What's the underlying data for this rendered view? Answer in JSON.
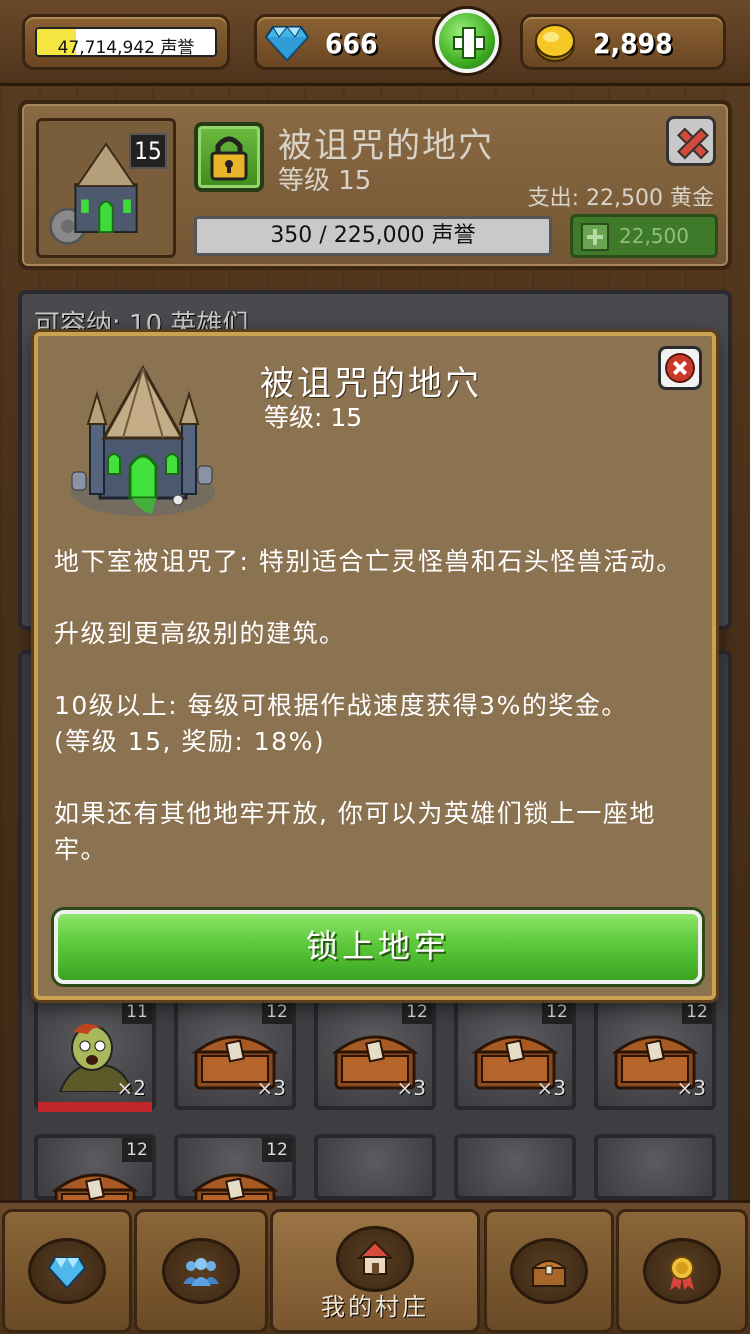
{
  "topbar": {
    "reputation": {
      "text": "47,714,942 声誉",
      "fill_fraction": 0.22
    },
    "gems": {
      "value": "666"
    },
    "gold": {
      "value": "2,898"
    }
  },
  "building": {
    "name": "被诅咒的地穴",
    "level_text": "等级 15",
    "thumb_level": "15",
    "cost_text": "支出: 22,500 黄金",
    "progress_text": "350 / 225,000 声誉",
    "upgrade_cost": "22,500"
  },
  "dungeon": {
    "capacity_text": "可容纳: 10 英雄们"
  },
  "modal": {
    "title": "被诅咒的地穴",
    "level_text": "等级: 15",
    "paragraphs": [
      "地下室被诅咒了: 特别适合亡灵怪兽和石头怪兽活动。",
      "升级到更高级别的建筑。",
      "10级以上: 每级可根据作战速度获得3%的奖金。",
      "(等级 15, 奖励: 18%)",
      "如果还有其他地牢开放, 你可以为英雄们锁上一座地牢。"
    ],
    "button_label": "锁上地牢"
  },
  "slots": [
    {
      "level": "11",
      "count": "×2",
      "item": "zombie"
    },
    {
      "level": "12",
      "count": "×3",
      "item": "chest"
    },
    {
      "level": "12",
      "count": "×3",
      "item": "chest"
    },
    {
      "level": "12",
      "count": "×3",
      "item": "chest"
    },
    {
      "level": "12",
      "count": "×3",
      "item": "chest"
    },
    {
      "level": "12",
      "count": "",
      "item": "chest"
    },
    {
      "level": "12",
      "count": "",
      "item": "chest"
    },
    {
      "level": "",
      "count": "",
      "item": "empty"
    },
    {
      "level": "",
      "count": "",
      "item": "empty"
    },
    {
      "level": "",
      "count": "",
      "item": "empty"
    }
  ],
  "bottomnav": {
    "tabs": [
      {
        "icon": "diamond-icon",
        "label": ""
      },
      {
        "icon": "heroes-icon",
        "label": ""
      },
      {
        "icon": "house-icon",
        "label": "我的村庄"
      },
      {
        "icon": "treasure-chest-icon",
        "label": ""
      },
      {
        "icon": "medal-icon",
        "label": ""
      }
    ],
    "active_index": 2
  },
  "colors": {
    "accent_green": "#5cc93a",
    "frame_gold": "#c9a352",
    "panel_brown": "#8b7251",
    "close_red": "#c9392b"
  }
}
